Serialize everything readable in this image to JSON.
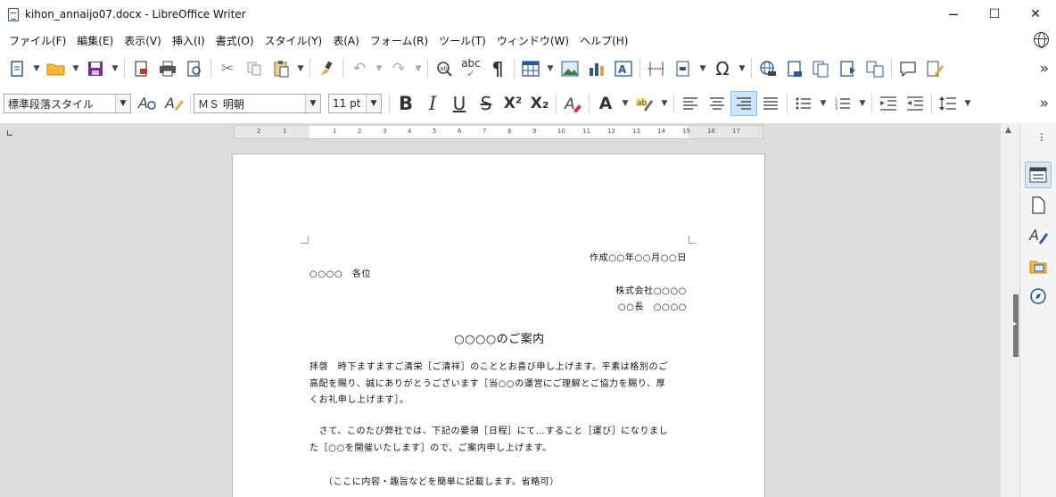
{
  "window": {
    "title": "kihon_annaijo07.docx - LibreOffice Writer",
    "minimize": "─",
    "maximize": "☐",
    "close": "✕"
  },
  "menu": [
    "ファイル(F)",
    "編集(E)",
    "表示(V)",
    "挿入(I)",
    "書式(O)",
    "スタイル(Y)",
    "表(A)",
    "フォーム(R)",
    "ツール(T)",
    "ウィンドウ(W)",
    "ヘルプ(H)"
  ],
  "formatting": {
    "paragraph_style": "標準段落スタイル",
    "font_name": "ＭＳ 明朝",
    "font_size": "11 pt"
  },
  "toolbar_glyphs": {
    "bold": "B",
    "italic": "I",
    "underline": "U",
    "strike": "S",
    "superscript": "X²",
    "subscript": "X₂",
    "spellcheck": "abc",
    "formatting_marks": "¶",
    "special_char": "Ω",
    "char_font": "A",
    "clear_format": "A",
    "more": "»"
  },
  "document": {
    "date": "作成○○年○○月○○日",
    "recipient": "○○○○　各位",
    "company": "株式会社○○○○",
    "sender": "○○長　○○○○",
    "title": "○○○○のご案内",
    "para1_lines": [
      "拝啓　時下ますますご清栄［ご清祥］のこととお喜び申し上げます。平素は格別のご",
      "高配を賜り、誠にありがとうございます［当○○の運営にご理解とご協力を賜り、厚",
      "くお礼申し上げます］。"
    ],
    "para2_lines": [
      "　さて、このたび弊社では、下記の要領［日程］にて…すること［運び］になりまし",
      "た［○○を開催いたします］ので、ご案内申し上げます。"
    ],
    "para3": "（ここに内容・趣旨などを簡単に記載します。省略可）"
  },
  "ruler_numbers": [
    "2",
    "1",
    "1",
    "2",
    "3",
    "4",
    "5",
    "6",
    "7",
    "8",
    "9",
    "10",
    "11",
    "12",
    "13",
    "14",
    "15",
    "16",
    "17"
  ]
}
